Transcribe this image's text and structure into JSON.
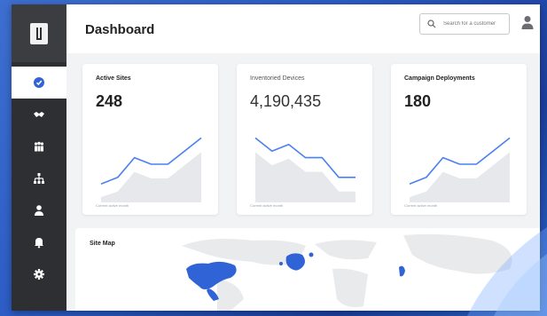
{
  "header": {
    "title": "Dashboard",
    "search_placeholder": "Search for a customer"
  },
  "sidebar": {
    "items": [
      {
        "icon": "gauge-icon",
        "active": true
      },
      {
        "icon": "handshake-icon",
        "active": false
      },
      {
        "icon": "group-icon",
        "active": false
      },
      {
        "icon": "hierarchy-icon",
        "active": false
      },
      {
        "icon": "person-icon",
        "active": false
      },
      {
        "icon": "bell-icon",
        "active": false
      },
      {
        "icon": "gear-icon",
        "active": false
      }
    ]
  },
  "cards": [
    {
      "title": "Active Sites",
      "value": "248",
      "footer": "Current active month",
      "trend": [
        2,
        3,
        6,
        5,
        5,
        7,
        9
      ]
    },
    {
      "title": "Inventoried Devices",
      "value": "4,190,435",
      "footer": "Current active month",
      "trend": [
        9,
        7,
        8,
        6,
        6,
        3,
        3
      ]
    },
    {
      "title": "Campaign Deployments",
      "value": "180",
      "footer": "Current active month",
      "trend": [
        2,
        3,
        6,
        5,
        5,
        7,
        9
      ]
    }
  ],
  "map": {
    "title": "Site Map"
  },
  "colors": {
    "accent": "#4a80f0",
    "sidebar": "#2d2f33",
    "map_highlight": "#2f63d6"
  }
}
